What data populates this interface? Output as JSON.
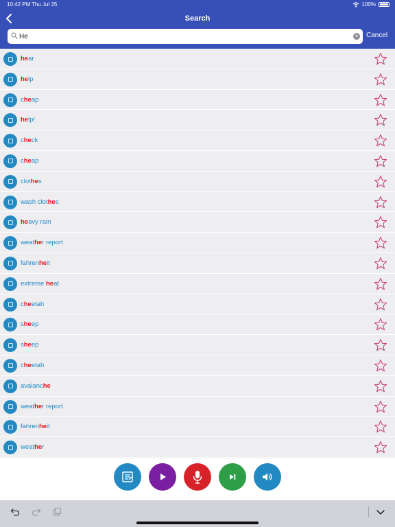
{
  "status": {
    "time": "10:42 PM",
    "date": "Thu Jul 25",
    "battery": "100%"
  },
  "nav": {
    "title": "Search",
    "back_icon": "chevron-left-icon"
  },
  "search": {
    "value": "He",
    "placeholder": "",
    "cancel_label": "Cancel"
  },
  "results": [
    {
      "parts": [
        "",
        "he",
        "ar"
      ]
    },
    {
      "parts": [
        "",
        "he",
        "lp"
      ]
    },
    {
      "parts": [
        "c",
        "he",
        "ap"
      ]
    },
    {
      "parts": [
        "",
        "he",
        "lp!"
      ]
    },
    {
      "parts": [
        "c",
        "he",
        "ck"
      ]
    },
    {
      "parts": [
        "c",
        "he",
        "ap"
      ]
    },
    {
      "parts": [
        "clot",
        "he",
        "s"
      ]
    },
    {
      "parts": [
        "wash clot",
        "he",
        "s"
      ]
    },
    {
      "parts": [
        "",
        "he",
        "avy rain"
      ]
    },
    {
      "parts": [
        "weat",
        "he",
        "r report"
      ]
    },
    {
      "parts": [
        "fahren",
        "he",
        "it"
      ]
    },
    {
      "parts": [
        "extreme ",
        "he",
        "at"
      ]
    },
    {
      "parts": [
        "c",
        "he",
        "etah"
      ]
    },
    {
      "parts": [
        "s",
        "he",
        "ep"
      ]
    },
    {
      "parts": [
        "s",
        "he",
        "ep"
      ]
    },
    {
      "parts": [
        "c",
        "he",
        "etah"
      ]
    },
    {
      "parts": [
        "avalanc",
        "he",
        ""
      ]
    },
    {
      "parts": [
        "weat",
        "he",
        "r report"
      ]
    },
    {
      "parts": [
        "fahren",
        "he",
        "it"
      ]
    },
    {
      "parts": [
        "weat",
        "he",
        "r"
      ]
    }
  ],
  "controls": [
    {
      "name": "notes",
      "icon": "notes-icon",
      "color": "#2389c3"
    },
    {
      "name": "play",
      "icon": "play-icon",
      "color": "#7a1fa2"
    },
    {
      "name": "mic",
      "icon": "microphone-icon",
      "color": "#d7222a"
    },
    {
      "name": "next",
      "icon": "skip-next-icon",
      "color": "#2e9e47"
    },
    {
      "name": "speaker",
      "icon": "speaker-icon",
      "color": "#2389c3"
    }
  ],
  "colors": {
    "header": "#3750b8",
    "word": "#2389c3",
    "highlight": "#e8131b",
    "star": "#c8437a",
    "list_bg": "#eeeef1"
  }
}
